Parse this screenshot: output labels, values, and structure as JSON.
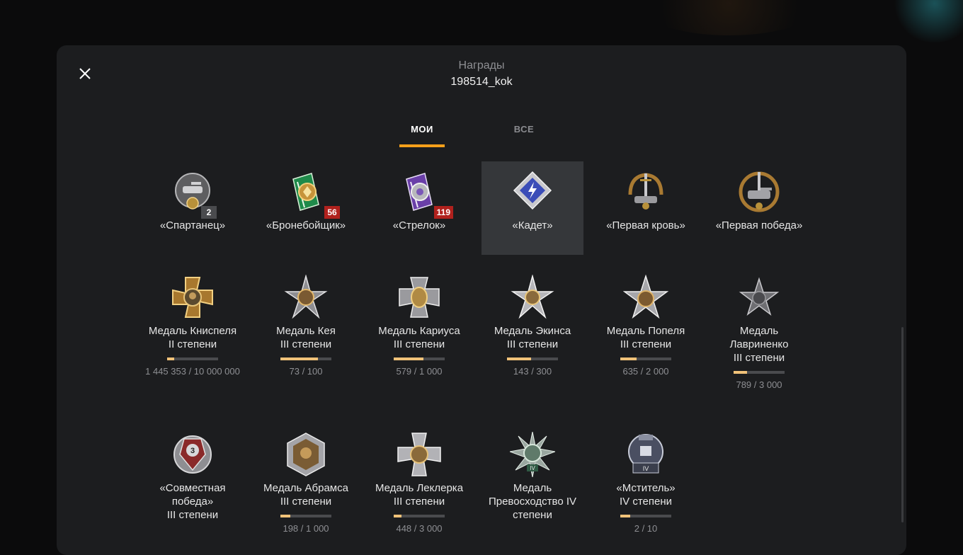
{
  "header": {
    "title": "Награды",
    "username": "198514_kok"
  },
  "tabs": [
    {
      "label": "МОИ",
      "active": true
    },
    {
      "label": "ВСЕ",
      "active": false
    }
  ],
  "colors": {
    "accent": "#f5a01a",
    "progress": "#f1c279",
    "badge_red": "#b0211d",
    "badge_gray": "#4a4b4e"
  },
  "row1": [
    {
      "name": "«Спартанец»",
      "badge": "2",
      "icon": "spartan-medal-icon"
    },
    {
      "name": "«Бронебойщик»",
      "badge": "56",
      "icon": "armor-piercer-medal-icon"
    },
    {
      "name": "«Стрелок»",
      "badge": "119",
      "icon": "sharpshooter-medal-icon"
    },
    {
      "name": "«Кадет»",
      "icon": "cadet-medal-icon",
      "selected": true
    },
    {
      "name": "«Первая кровь»",
      "icon": "first-blood-medal-icon"
    },
    {
      "name": "«Первая победа»",
      "icon": "first-victory-medal-icon"
    }
  ],
  "row2": [
    {
      "name_line1": "Медаль Книспеля",
      "name_line2": "II степени",
      "progress": 0.145,
      "count": "1 445 353 / 10 000 000",
      "icon": "knispel-medal-icon"
    },
    {
      "name_line1": "Медаль Кея",
      "name_line2": "III степени",
      "progress": 0.73,
      "count": "73 / 100",
      "icon": "kay-medal-icon"
    },
    {
      "name_line1": "Медаль Кариуса",
      "name_line2": "III степени",
      "progress": 0.579,
      "count": "579 / 1 000",
      "icon": "carius-medal-icon"
    },
    {
      "name_line1": "Медаль Экинса",
      "name_line2": "III степени",
      "progress": 0.477,
      "count": "143 / 300",
      "icon": "ekins-medal-icon"
    },
    {
      "name_line1": "Медаль Попеля",
      "name_line2": "III степени",
      "progress": 0.318,
      "count": "635 / 2 000",
      "icon": "popel-medal-icon"
    },
    {
      "name_line1": "Медаль",
      "name_line2": "Лавриненко",
      "name_line3": "III степени",
      "progress": 0.263,
      "count": "789 / 3 000",
      "icon": "lavrinenko-medal-icon"
    }
  ],
  "row3": [
    {
      "name_line1": "«Совместная",
      "name_line2": "победа»",
      "name_line3": "III степени",
      "icon": "joint-victory-medal-icon",
      "badge": "3"
    },
    {
      "name_line1": "Медаль Абрамса",
      "name_line2": "III степени",
      "progress": 0.198,
      "count": "198 / 1 000",
      "icon": "abrams-medal-icon"
    },
    {
      "name_line1": "Медаль Леклерка",
      "name_line2": "III степени",
      "progress": 0.149,
      "count": "448 / 3 000",
      "icon": "leclerc-medal-icon"
    },
    {
      "name_line1": "Медаль",
      "name_line2": "Превосходство IV",
      "name_line3": "степени",
      "icon": "supremacy-medal-icon",
      "ribbon": "IV"
    },
    {
      "name_line1": "«Мститель»",
      "name_line2": "IV степени",
      "progress": 0.2,
      "count": "2 / 10",
      "icon": "avenger-medal-icon",
      "ribbon": "IV"
    }
  ]
}
